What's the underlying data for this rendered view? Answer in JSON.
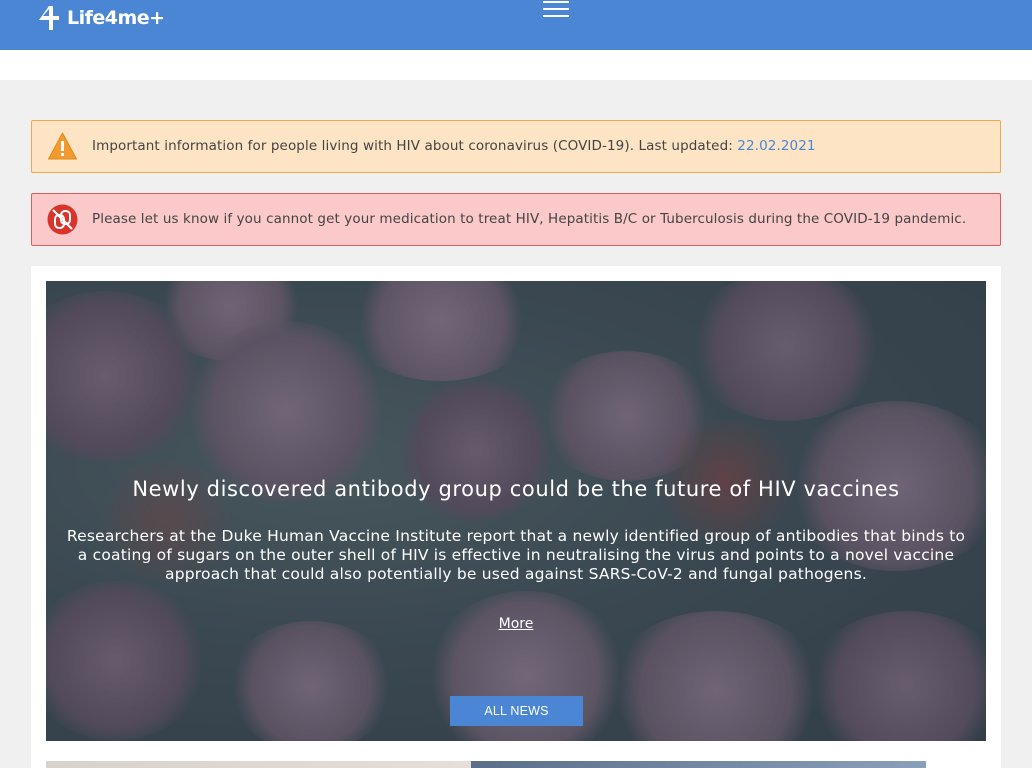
{
  "header": {
    "logo_text": "Life4me+",
    "menu_icon": "hamburger-icon",
    "bg_color": "#4a86d4"
  },
  "alerts": {
    "warning": {
      "icon": "warning-triangle-icon",
      "text": "Important information for people living with HIV about coronavirus (COVID-19). Last updated: ",
      "date": "22.02.2021"
    },
    "danger": {
      "icon": "no-pills-icon",
      "text": "Please let us know if you cannot get your medication to treat HIV, Hepatitis B/C or Tuberculosis during the COVID-19 pandemic."
    }
  },
  "hero": {
    "title": "Newly discovered antibody group could be the future of HIV vaccines",
    "description": "Researchers at the Duke Human Vaccine Institute report that a newly identified group of antibodies that binds to a coating of sugars on the outer shell of HIV is effective in neutralising the virus and points to a novel vaccine approach that could also potentially be used against SARS-CoV-2 and fungal pathogens.",
    "more_label": "More",
    "all_news_label": "ALL NEWS"
  },
  "colors": {
    "accent": "#4a86d4",
    "warning_bg": "#fde4c4",
    "warning_border": "#f0a64a",
    "danger_bg": "#fbc9c9",
    "danger_border": "#e05b5b"
  }
}
